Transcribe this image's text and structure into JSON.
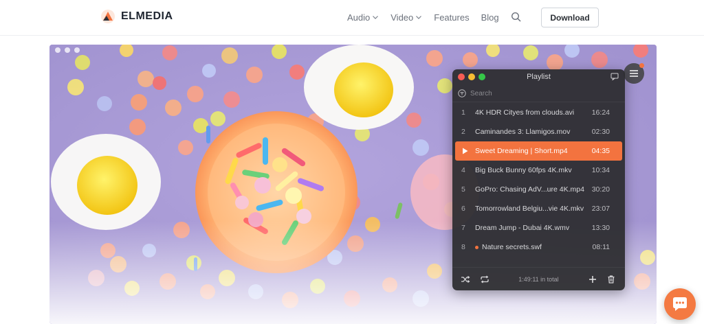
{
  "header": {
    "brand": "ELMEDIA",
    "nav": [
      {
        "label": "Audio"
      },
      {
        "label": "Video"
      },
      {
        "label": "Features"
      },
      {
        "label": "Blog"
      }
    ],
    "download_label": "Download"
  },
  "playlist": {
    "title": "Playlist",
    "search_placeholder": "Search",
    "items": [
      {
        "num": "1",
        "name": "4K HDR Cityes from clouds.avi",
        "duration": "16:24"
      },
      {
        "num": "2",
        "name": "Caminandes 3: Llamigos.mov",
        "duration": "02:30"
      },
      {
        "num": "3",
        "name": "Sweet Dreaming | Short.mp4",
        "duration": "04:35"
      },
      {
        "num": "4",
        "name": "Big Buck Bunny 60fps 4K.mkv",
        "duration": "10:34"
      },
      {
        "num": "5",
        "name": "GoPro: Chasing AdV...ure 4K.mp4",
        "duration": "30:20"
      },
      {
        "num": "6",
        "name": "Tomorrowland Belgiu...vie 4K.mkv",
        "duration": "23:07"
      },
      {
        "num": "7",
        "name": "Dream Jump - Dubai 4K.wmv",
        "duration": "13:30"
      },
      {
        "num": "8",
        "name": "Nature secrets.swf",
        "duration": "08:11"
      }
    ],
    "active_index": 2,
    "total": "1:49:11 in total"
  },
  "colors": {
    "accent": "#f3733f",
    "hero_background": "#a99bd6",
    "playlist_background": "#2d2d30"
  },
  "icons": [
    "logo-icon",
    "chevron-down-icon",
    "search-icon",
    "chat-icon",
    "filter-icon",
    "play-icon",
    "shuffle-icon",
    "repeat-icon",
    "plus-icon",
    "trash-icon",
    "list-icon",
    "chat-bubble-icon"
  ]
}
